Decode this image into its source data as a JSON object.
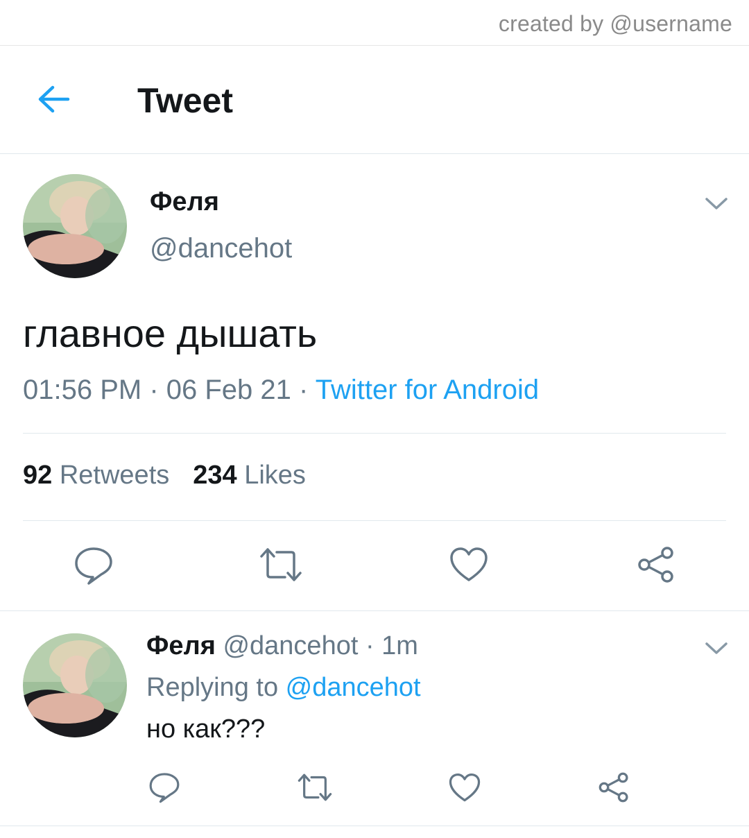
{
  "watermark": {
    "text": "created by @username"
  },
  "header": {
    "title": "Tweet",
    "back_icon": "arrow-left-icon"
  },
  "colors": {
    "accent": "#1da1f2",
    "secondary_text": "#657786",
    "border": "#e1e8ed"
  },
  "tweet": {
    "author_name": "Феля",
    "handle": "@dancehot",
    "text": "главное дышать",
    "time": "01:56 PM",
    "sep1": " · ",
    "date": "06 Feb 21",
    "sep2": " · ",
    "source": "Twitter for Android",
    "retweets_count": "92",
    "retweets_label": "Retweets",
    "likes_count": "234",
    "likes_label": "Likes"
  },
  "reply": {
    "author_name": "Феля",
    "handle": "@dancehot",
    "sep": " · ",
    "age": "1m",
    "replying_to_label": "Replying to ",
    "replying_to_handle": "@dancehot",
    "text": "но как???"
  },
  "actions": [
    "reply-icon",
    "retweet-icon",
    "like-icon",
    "share-icon"
  ]
}
